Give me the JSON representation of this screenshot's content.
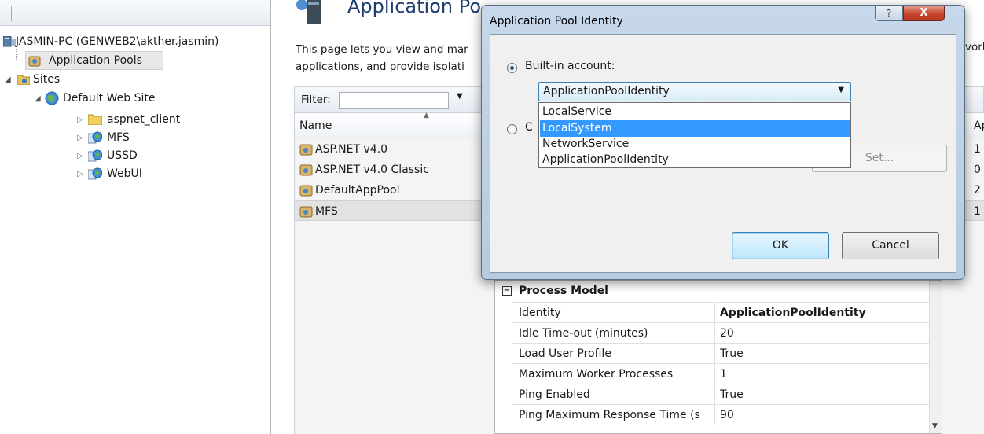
{
  "tree": {
    "server": "JASMIN-PC (GENWEB2\\akther.jasmin)",
    "application_pools": "Application Pools",
    "sites": "Sites",
    "default_site": "Default Web Site",
    "children": [
      "aspnet_client",
      "MFS",
      "USSD",
      "WebUI"
    ]
  },
  "page": {
    "heading": "Application Po",
    "desc_line1": "This page lets you view and mar",
    "desc_line2": "applications, and provide isolati",
    "right_cut": "vorl"
  },
  "filter": {
    "label": "Filter:",
    "value": ""
  },
  "grid": {
    "col_name": "Name",
    "col_ap": "Ap",
    "rows": [
      {
        "name": "ASP.NET v4.0",
        "ap": "1"
      },
      {
        "name": "ASP.NET v4.0 Classic",
        "ap": "0"
      },
      {
        "name": "DefaultAppPool",
        "ap": "2"
      },
      {
        "name": "MFS",
        "ap": "1"
      }
    ]
  },
  "dialog": {
    "title": "Application Pool Identity",
    "help": "?",
    "close": "X",
    "builtin_label": "Built-in account:",
    "custom_label": "C",
    "combo_value": "ApplicationPoolIdentity",
    "options": [
      "LocalService",
      "LocalSystem",
      "NetworkService",
      "ApplicationPoolIdentity"
    ],
    "highlighted_option": "LocalSystem",
    "set_label": "Set...",
    "ok_label": "OK",
    "cancel_label": "Cancel"
  },
  "properties": {
    "group": "Process Model",
    "rows": [
      {
        "key": "Identity",
        "value": "ApplicationPoolIdentity"
      },
      {
        "key": "Idle Time-out (minutes)",
        "value": "20"
      },
      {
        "key": "Load User Profile",
        "value": "True"
      },
      {
        "key": "Maximum Worker Processes",
        "value": "1"
      },
      {
        "key": "Ping Enabled",
        "value": "True"
      },
      {
        "key": "Ping Maximum Response Time (s",
        "value": "90"
      }
    ]
  },
  "colors": {
    "selection": "#3399ff",
    "accent_blue": "#3c7fb1",
    "close_red": "#c7432d"
  }
}
